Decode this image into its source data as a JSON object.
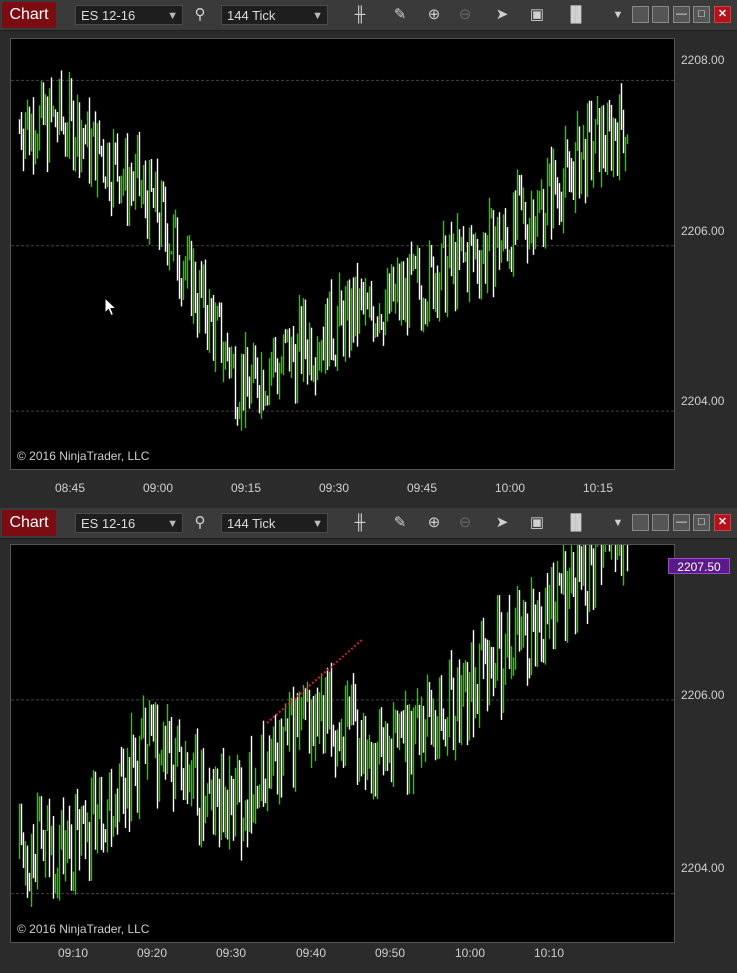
{
  "windows": [
    {
      "title": "Chart",
      "instrument": "ES 12-16",
      "interval": "144 Tick",
      "copyright": "© 2016 NinjaTrader, LLC",
      "x_labels": [
        "08:45",
        "09:00",
        "09:15",
        "09:30",
        "09:45",
        "10:00",
        "10:15"
      ],
      "y_labels": [
        "2208.00",
        "2206.00",
        "2204.00"
      ]
    },
    {
      "title": "Chart",
      "instrument": "ES 12-16",
      "interval": "144 Tick",
      "copyright": "© 2016 NinjaTrader, LLC",
      "x_labels": [
        "09:10",
        "09:20",
        "09:30",
        "09:40",
        "09:50",
        "10:00",
        "10:10"
      ],
      "y_labels": [
        "2206.00",
        "2204.00"
      ],
      "last_price": "2207.50"
    }
  ],
  "chart_data": [
    {
      "type": "line",
      "series_note": "",
      "x": [
        "08:45",
        "09:00",
        "09:15",
        "09:30",
        "09:45",
        "10:00",
        "10:15"
      ],
      "y": [
        2207.5,
        2206.5,
        2204.3,
        2205.0,
        2205.5,
        2206.1,
        2207.2
      ],
      "ylim": [
        2203.3,
        2208.5
      ],
      "grid": true
    },
    {
      "type": "line",
      "x": [
        "09:10",
        "09:20",
        "09:30",
        "09:40",
        "09:50",
        "10:00",
        "10:10"
      ],
      "y": [
        2204.5,
        2205.5,
        2204.8,
        2205.8,
        2205.5,
        2206.1,
        2206.9
      ],
      "ylim": [
        2203.5,
        2207.6
      ],
      "grid": true
    }
  ],
  "colors": {
    "up_bar": "#4caf2a",
    "down_bar": "#ffffff",
    "background": "#000000",
    "drawing": "#d02030",
    "price_marker": "#5a1a8a"
  }
}
